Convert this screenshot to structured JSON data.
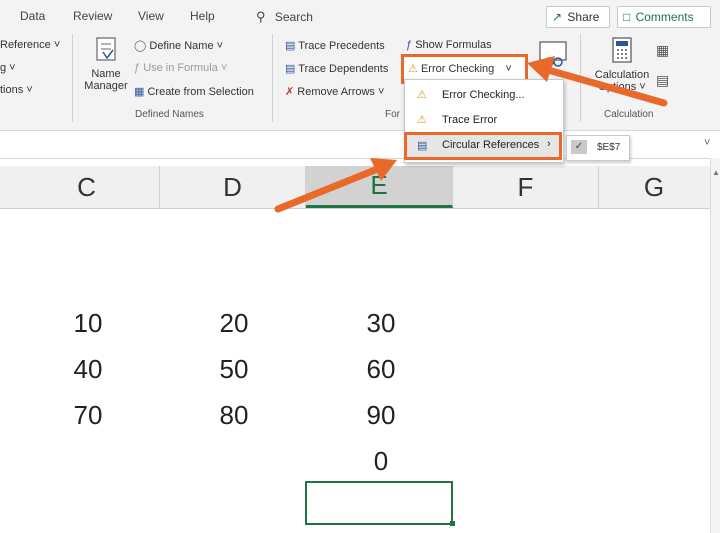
{
  "ribbon": {
    "tabs": [
      "Data",
      "Review",
      "View",
      "Help"
    ],
    "search": "Search",
    "share": "Share",
    "comments": "Comments",
    "left_cut": [
      "Reference",
      "g",
      "tions"
    ],
    "defined_names": {
      "name_manager_1": "Name",
      "name_manager_2": "Manager",
      "define_name": "Define Name",
      "use_in_formula": "Use in Formula",
      "create_from_selection": "Create from Selection",
      "group": "Defined Names"
    },
    "formula_auditing": {
      "trace_precedents": "Trace Precedents",
      "trace_dependents": "Trace Dependents",
      "remove_arrows": "Remove Arrows",
      "show_formulas": "Show Formulas",
      "error_checking": "Error Checking",
      "group_cut": "For"
    },
    "calculation": {
      "options_1": "Calculation",
      "options_2": "Options",
      "group": "Calculation"
    }
  },
  "dropdown": {
    "error_checking": "Error Checking...",
    "trace_error": "Trace Error",
    "circular_references": "Circular References",
    "submenu_item": "$E$7"
  },
  "sheet": {
    "columns": [
      "C",
      "D",
      "E",
      "F",
      "G"
    ],
    "rows": [
      [
        "10",
        "20",
        "30"
      ],
      [
        "40",
        "50",
        "60"
      ],
      [
        "70",
        "80",
        "90"
      ],
      [
        "",
        "",
        "0"
      ]
    ]
  },
  "colors": {
    "highlight": "#e8692a",
    "selection": "#217346",
    "ribbon_bg": "#f3f3f3"
  }
}
